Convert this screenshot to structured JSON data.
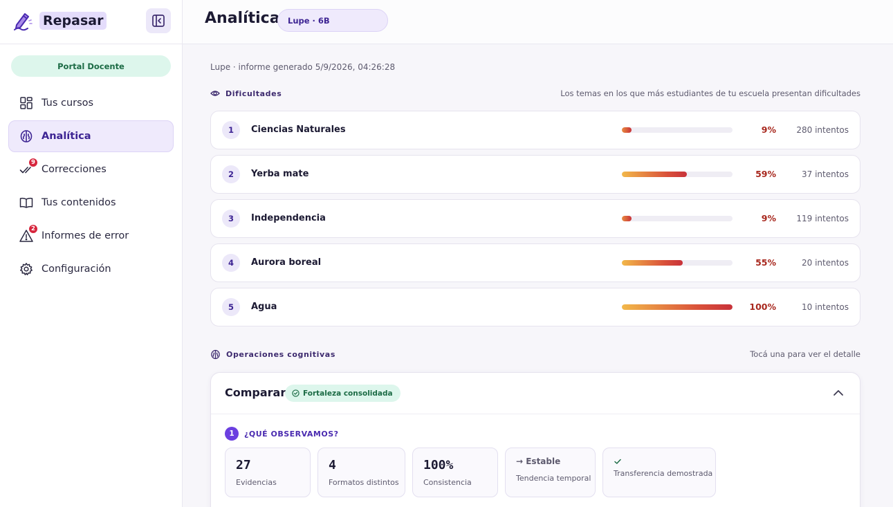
{
  "app": {
    "name": "Repasar"
  },
  "sidebar": {
    "portal_label": "Portal Docente",
    "items": [
      {
        "label": "Tus cursos",
        "icon": "grid-icon",
        "active": false
      },
      {
        "label": "Analítica",
        "icon": "brain-icon",
        "active": true
      },
      {
        "label": "Correcciones",
        "icon": "double-check-icon",
        "active": false,
        "badge": "9"
      },
      {
        "label": "Tus contenidos",
        "icon": "book-icon",
        "active": false
      },
      {
        "label": "Informes de error",
        "icon": "warning-icon",
        "active": false,
        "badge": "2"
      },
      {
        "label": "Configuración",
        "icon": "gear-icon",
        "active": false
      }
    ]
  },
  "header": {
    "title": "Analítica",
    "class_pill": "Lupe · 6B"
  },
  "report": {
    "meta": "Lupe · informe generado 5/9/2026, 04:26:28"
  },
  "difficulties": {
    "title": "Dificultades",
    "note": "Los temas en los que más estudiantes de tu escuela presentan dificultades",
    "topics": [
      {
        "rank": "1",
        "name": "Ciencias Naturales",
        "percent": 9,
        "percent_label": "9%",
        "attempts": "280 intentos"
      },
      {
        "rank": "2",
        "name": "Yerba mate",
        "percent": 59,
        "percent_label": "59%",
        "attempts": "37 intentos"
      },
      {
        "rank": "3",
        "name": "Independencia",
        "percent": 9,
        "percent_label": "9%",
        "attempts": "119 intentos"
      },
      {
        "rank": "4",
        "name": "Aurora boreal",
        "percent": 55,
        "percent_label": "55%",
        "attempts": "20 intentos"
      },
      {
        "rank": "5",
        "name": "Agua",
        "percent": 100,
        "percent_label": "100%",
        "attempts": "10 intentos"
      }
    ]
  },
  "operations": {
    "title": "Operaciones cognitivas",
    "note": "Tocá una para ver el detalle",
    "card": {
      "name": "Comparar",
      "status": "Fortaleza consolidada",
      "observe_number": "1",
      "observe_title": "¿QUÉ OBSERVAMOS?",
      "stats": [
        {
          "value": "27",
          "label": "Evidencias"
        },
        {
          "value": "4",
          "label": "Formatos distintos"
        },
        {
          "value": "100%",
          "label": "Consistencia"
        },
        {
          "value": "→ Estable",
          "label": "Tendencia temporal"
        },
        {
          "value": "",
          "label": "Transferencia demostrada"
        }
      ]
    }
  },
  "colors": {
    "accent": "#6b3fe0",
    "danger": "#a8281e",
    "success": "#1c6b45"
  }
}
